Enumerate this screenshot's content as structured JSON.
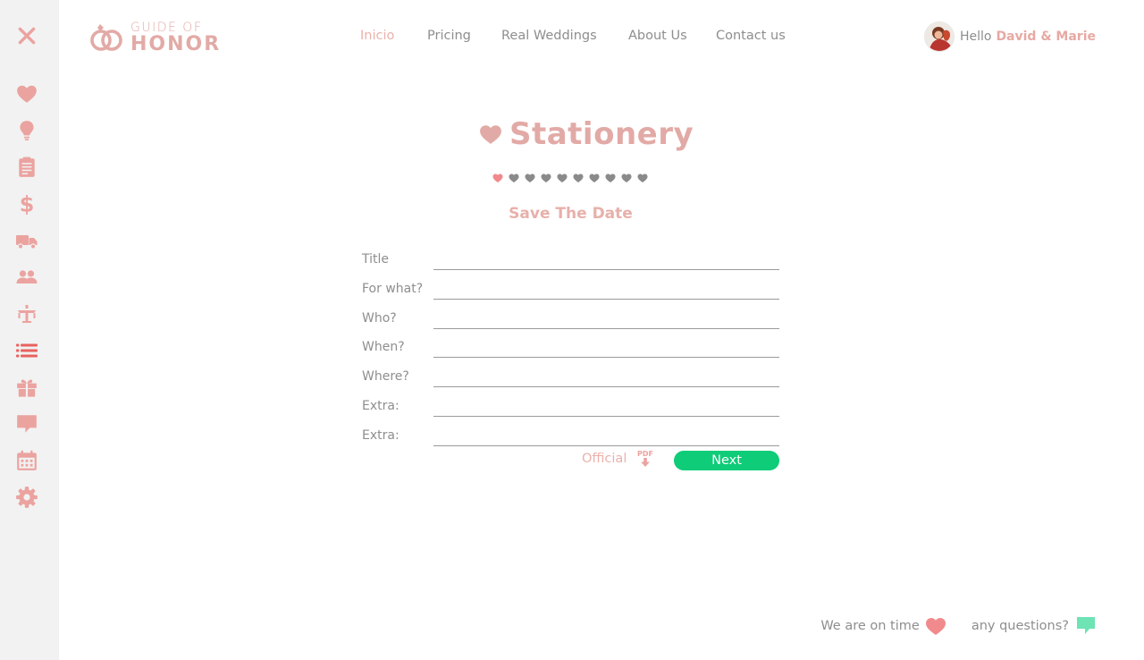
{
  "brand": {
    "logo_line1": "GUIDE OF",
    "logo_line2": "HONOR"
  },
  "nav": {
    "items": [
      {
        "label": "Inicio",
        "active": true
      },
      {
        "label": "Pricing",
        "active": false
      },
      {
        "label": "Real Weddings",
        "active": false
      },
      {
        "label": "About Us",
        "active": false
      },
      {
        "label": "Contact us",
        "active": false
      }
    ]
  },
  "user": {
    "greeting": "Hello",
    "name": "David & Marie"
  },
  "sidebar": {
    "icons": [
      "close-icon",
      "heart-icon",
      "lightbulb-icon",
      "notepad-icon",
      "dollar-icon",
      "truck-icon",
      "people-icon",
      "table-icon",
      "list-icon",
      "gift-icon",
      "chat-icon",
      "calendar-icon",
      "settings-icon"
    ],
    "active_icon": "list-icon"
  },
  "page": {
    "title": "Stationery",
    "subtitle": "Save The Date",
    "steps_total": 10,
    "steps_current": 1
  },
  "form": {
    "fields": [
      {
        "label": "Title",
        "value": ""
      },
      {
        "label": "For what?",
        "value": ""
      },
      {
        "label": "Who?",
        "value": ""
      },
      {
        "label": "When?",
        "value": ""
      },
      {
        "label": "Where?",
        "value": ""
      },
      {
        "label": "Extra:",
        "value": ""
      },
      {
        "label": "Extra:",
        "value": ""
      }
    ],
    "official_label": "Official",
    "pdf_label": "PDF",
    "next_label": "Next"
  },
  "footer": {
    "on_time_text": "We are on time",
    "questions_text": "any questions?"
  },
  "colors": {
    "accent_pink": "#e2aaa6",
    "sidebar_icon": "#eba3a0",
    "active_icon": "#e8625e",
    "next_button": "#0ecc78",
    "chat_green": "#6ee3b4",
    "sidebar_bg": "#f2f2f2",
    "progress_inactive": "#8a8a8a",
    "progress_active": "#f08a8c"
  }
}
